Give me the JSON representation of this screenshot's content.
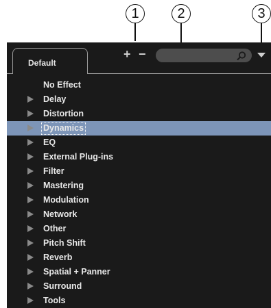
{
  "callouts": [
    "1",
    "2",
    "3"
  ],
  "panel": {
    "tab_label": "Default",
    "toolbar": {
      "add_label": "+",
      "remove_label": "−",
      "search_placeholder": "",
      "search_icon": "search-icon",
      "menu_icon": "chevron-down-icon"
    },
    "colors": {
      "background": "#1a1a1a",
      "selection": "#7d95b8",
      "text": "#e8e8e8"
    },
    "effects": [
      {
        "label": "No Effect",
        "expandable": false,
        "selected": false
      },
      {
        "label": "Delay",
        "expandable": true,
        "selected": false
      },
      {
        "label": "Distortion",
        "expandable": true,
        "selected": false
      },
      {
        "label": "Dynamics",
        "expandable": true,
        "selected": true
      },
      {
        "label": "EQ",
        "expandable": true,
        "selected": false
      },
      {
        "label": "External Plug-ins",
        "expandable": true,
        "selected": false
      },
      {
        "label": "Filter",
        "expandable": true,
        "selected": false
      },
      {
        "label": "Mastering",
        "expandable": true,
        "selected": false
      },
      {
        "label": "Modulation",
        "expandable": true,
        "selected": false
      },
      {
        "label": "Network",
        "expandable": true,
        "selected": false
      },
      {
        "label": "Other",
        "expandable": true,
        "selected": false
      },
      {
        "label": "Pitch Shift",
        "expandable": true,
        "selected": false
      },
      {
        "label": "Reverb",
        "expandable": true,
        "selected": false
      },
      {
        "label": "Spatial + Panner",
        "expandable": true,
        "selected": false
      },
      {
        "label": "Surround",
        "expandable": true,
        "selected": false
      },
      {
        "label": "Tools",
        "expandable": true,
        "selected": false
      }
    ]
  }
}
